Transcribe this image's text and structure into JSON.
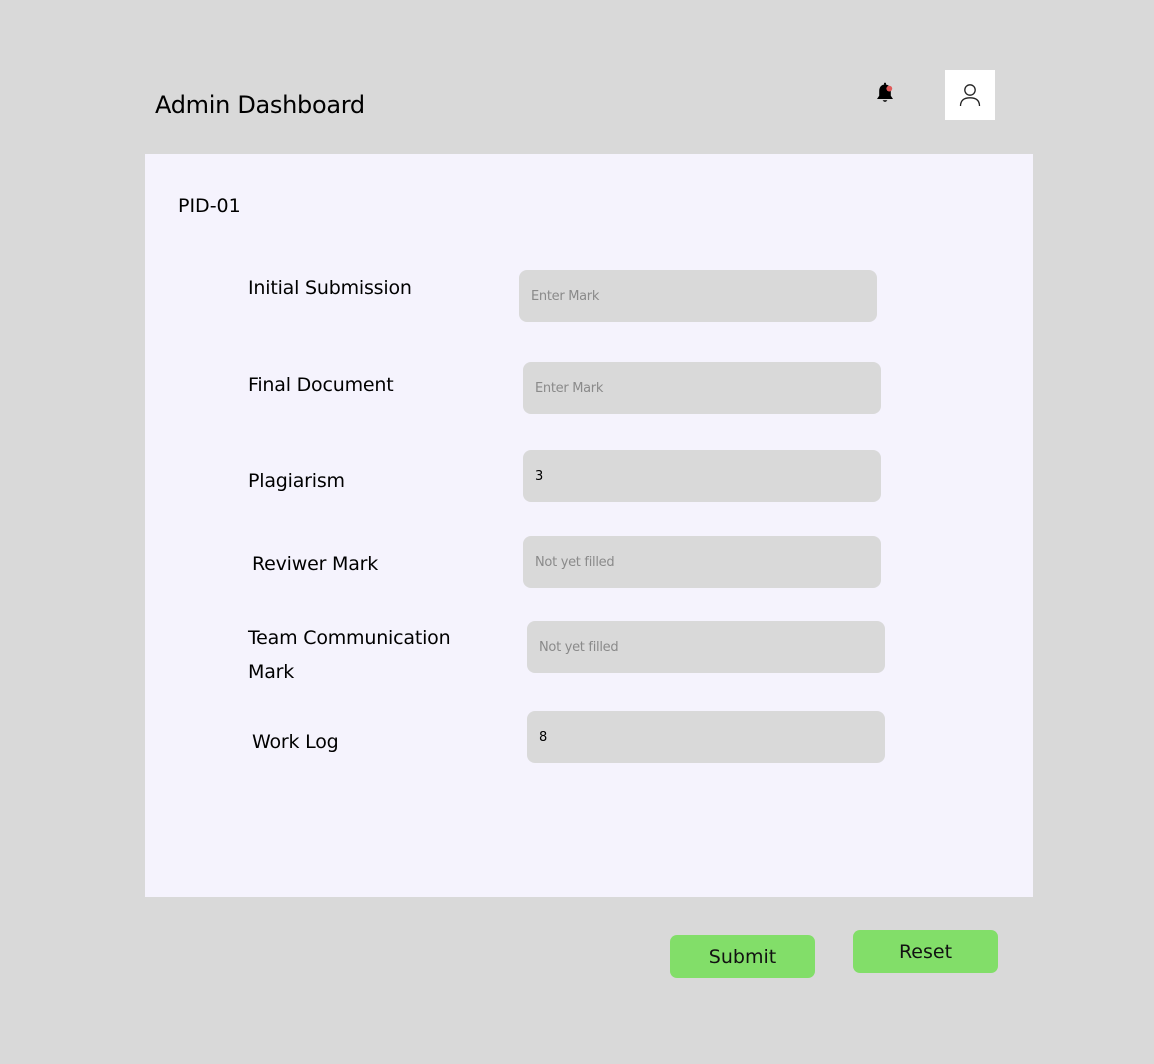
{
  "header": {
    "title": "Admin Dashboard",
    "notification_icon": "bell-icon",
    "profile_icon": "user-icon"
  },
  "form": {
    "project_id": "PID-01",
    "fields": [
      {
        "label": "Initial Submission",
        "value": "",
        "placeholder": "Enter Mark"
      },
      {
        "label": "Final Document",
        "value": "",
        "placeholder": "Enter Mark"
      },
      {
        "label": "Plagiarism",
        "value": "3",
        "placeholder": ""
      },
      {
        "label": "Reviwer Mark",
        "value": "",
        "placeholder": "Not yet filled"
      },
      {
        "label": "Team Communication Mark",
        "value": "",
        "placeholder": "Not yet filled"
      },
      {
        "label": "Work Log",
        "value": "8",
        "placeholder": ""
      }
    ]
  },
  "actions": {
    "submit_label": "Submit",
    "reset_label": "Reset"
  },
  "colors": {
    "background": "#d9d9d9",
    "panel": "#f5f3fd",
    "field": "#d9d9d9",
    "button": "#82de69",
    "notification_dot": "#e05a5a"
  }
}
